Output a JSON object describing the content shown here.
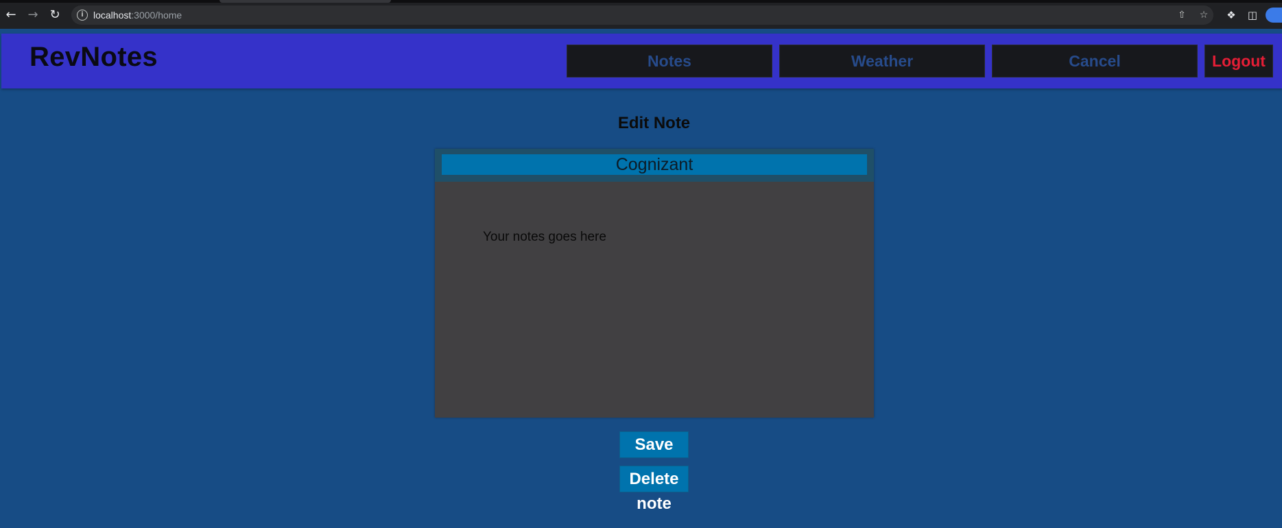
{
  "browser": {
    "url_host": "localhost",
    "url_path": ":3000/home",
    "icons": [
      "back-icon",
      "forward-icon",
      "reload-icon",
      "site-info-icon",
      "share-icon",
      "bookmark-star-icon",
      "extensions-icon",
      "side-panel-icon",
      "profile-avatar"
    ]
  },
  "app": {
    "brand": "RevNotes",
    "nav": {
      "notes": "Notes",
      "weather": "Weather",
      "cancel": "Cancel",
      "logout": "Logout"
    }
  },
  "editor": {
    "heading": "Edit Note",
    "title_value": "Cognizant",
    "body_placeholder": "Your notes goes here"
  },
  "actions": {
    "save": "Save",
    "delete": "Delete",
    "delete_suffix": "note"
  },
  "colors": {
    "page_bg": "#174c85",
    "navbar_bg": "#3532c9",
    "nav_button_bg": "#17181c",
    "nav_button_text": "#274b8b",
    "logout_text": "#e51e36",
    "editor_bg": "#414042",
    "title_input_bg": "#0073ad",
    "action_button_bg": "#0073ad"
  }
}
